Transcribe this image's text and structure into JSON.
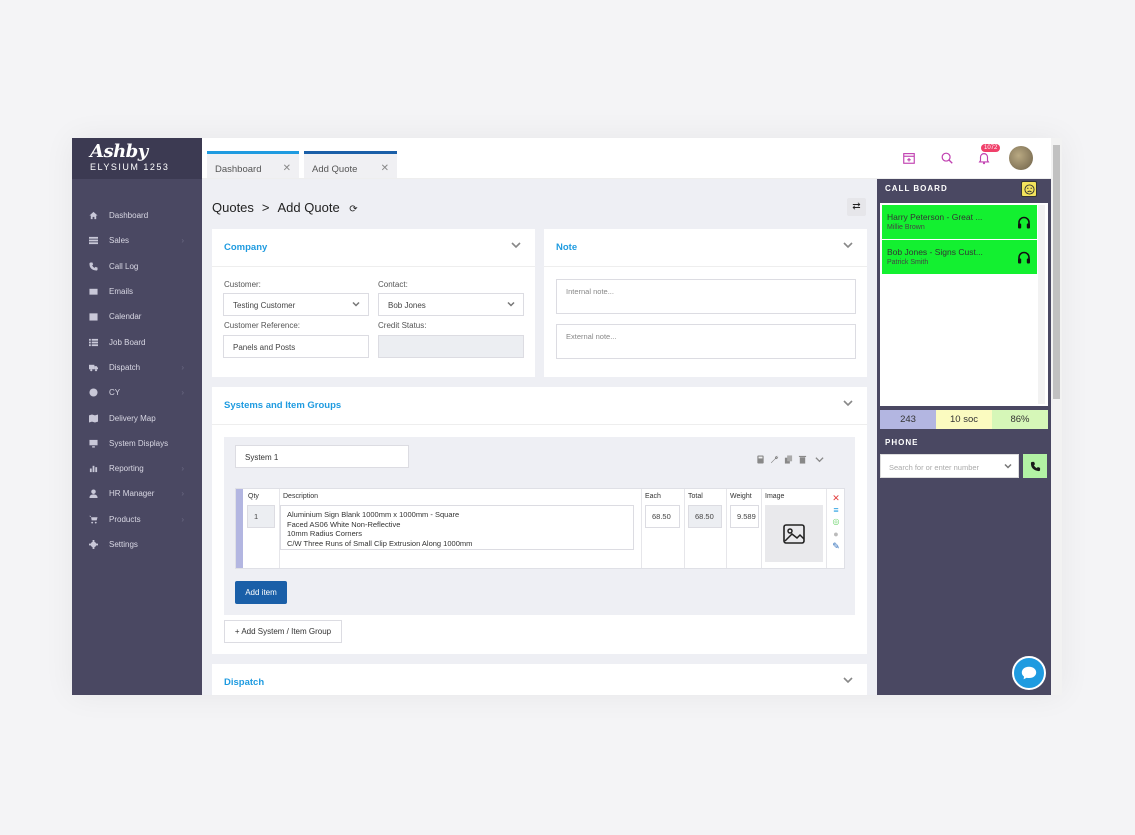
{
  "brand": {
    "logo": "Ashby",
    "subtitle": "ELYSIUM 1253"
  },
  "sidebar": {
    "items": [
      {
        "label": "Dashboard",
        "icon": "home-icon"
      },
      {
        "label": "Sales",
        "icon": "list-icon"
      },
      {
        "label": "Call Log",
        "icon": "phone-icon"
      },
      {
        "label": "Emails",
        "icon": "envelope-icon"
      },
      {
        "label": "Calendar",
        "icon": "calendar-icon"
      },
      {
        "label": "Job Board",
        "icon": "tasks-icon"
      },
      {
        "label": "Dispatch",
        "icon": "truck-icon"
      },
      {
        "label": "CY",
        "icon": "palette-icon"
      },
      {
        "label": "Delivery Map",
        "icon": "map-icon"
      },
      {
        "label": "System Displays",
        "icon": "monitor-icon"
      },
      {
        "label": "Reporting",
        "icon": "chart-icon"
      },
      {
        "label": "HR Manager",
        "icon": "user-icon"
      },
      {
        "label": "Products",
        "icon": "cart-icon"
      },
      {
        "label": "Settings",
        "icon": "gear-icon"
      }
    ]
  },
  "tabs": [
    {
      "label": "Dashboard"
    },
    {
      "label": "Add Quote"
    }
  ],
  "header": {
    "notification_count": "1072"
  },
  "breadcrumb": {
    "root": "Quotes",
    "sep": ">",
    "current": "Add Quote"
  },
  "company": {
    "title": "Company",
    "customer_label": "Customer:",
    "customer_value": "Testing Customer",
    "contact_label": "Contact:",
    "contact_value": "Bob Jones",
    "reference_label": "Customer Reference:",
    "reference_value": "Panels and Posts",
    "credit_label": "Credit Status:",
    "credit_value": ""
  },
  "note": {
    "title": "Note",
    "internal_placeholder": "Internal note...",
    "external_placeholder": "External note..."
  },
  "systems": {
    "title": "Systems and Item Groups",
    "system_name": "System 1",
    "columns": {
      "qty": "Qty",
      "description": "Description",
      "each": "Each",
      "total": "Total",
      "weight": "Weight",
      "image": "Image"
    },
    "item": {
      "qty": "1",
      "description_lines": [
        "Aluminium Sign Blank 1000mm x 1000mm - Square",
        "Faced AS06 White Non-Reflective",
        "10mm Radius Corners",
        "C/W Three Runs of Small Clip Extrusion Along 1000mm"
      ],
      "each": "68.50",
      "total": "68.50",
      "weight": "9.589"
    },
    "add_item": "Add item",
    "add_system": "+ Add System / Item Group"
  },
  "dispatch": {
    "title": "Dispatch"
  },
  "call_board": {
    "title": "CALL BOARD",
    "calls": [
      {
        "name": "Harry Peterson - Great ...",
        "sub": "Millie Brown"
      },
      {
        "name": "Bob Jones - Signs Cust...",
        "sub": "Patrick Smith"
      }
    ],
    "stats": [
      {
        "value": "243",
        "color": "#b3b6e1"
      },
      {
        "value": "10 soc",
        "color": "#fbfbc0"
      },
      {
        "value": "86%",
        "color": "#d6f7b8"
      }
    ]
  },
  "phone": {
    "title": "PHONE",
    "placeholder": "Search for or enter number"
  },
  "colors": {
    "accent": "#1f9be0",
    "primary": "#1a5fa8",
    "sidebar": "#4a4862",
    "call_active": "#13f030"
  }
}
